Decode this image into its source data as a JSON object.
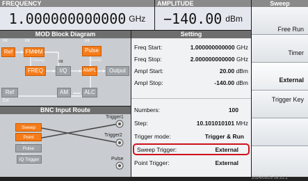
{
  "header": {
    "frequency_label": "FREQUENCY",
    "amplitude_label": "AMPLITUDE",
    "sweep_label": "Sweep"
  },
  "frequency": {
    "value": "1.000000000000",
    "unit": "GHz"
  },
  "amplitude": {
    "value": "−140.00",
    "unit": "dBm"
  },
  "mod": {
    "title": "MOD Block Diagram",
    "int1": "Int",
    "int2": "Int",
    "ref": "Ref",
    "fmpm": "FMΦM",
    "pulse": "Pulse",
    "sweep1": "Sweep",
    "int3": "Int",
    "sweep2": "Sweep",
    "freq": "FREQ",
    "iq": "I/Q",
    "ampl": "AMPL",
    "output": "Output",
    "ref2": "Ref",
    "ext": "Ext",
    "am": "AM",
    "alc": "ALC"
  },
  "bnc": {
    "title": "BNC Input Route",
    "sweep_trigger": "Sweep Trigger",
    "point_trigger": "Point Trigger",
    "pulse_trigger": "Pulse Trigger",
    "iq_trigger": "IQ Trigger",
    "trigger1": "Trigger1",
    "trigger2": "Trigger2",
    "pulse": "Pulse"
  },
  "setting": {
    "title": "Setting",
    "rows": [
      {
        "label": "Freq Start:",
        "value": "1.000000000000",
        "unit": "GHz"
      },
      {
        "label": "Freq Stop:",
        "value": "2.000000000000",
        "unit": "GHz"
      },
      {
        "label": "Ampl Start:",
        "value": "20.00",
        "unit": "dBm"
      },
      {
        "label": "Ampl Stop:",
        "value": "-140.00",
        "unit": "dBm"
      }
    ],
    "rows2": [
      {
        "label": "Numbers:",
        "value": "100",
        "unit": ""
      },
      {
        "label": "Step:",
        "value": "10.101010101",
        "unit": "MHz"
      },
      {
        "label": "Trigger mode:",
        "value": "Trigger & Run",
        "unit": ""
      },
      {
        "label": "Sweep Trigger:",
        "value": "External",
        "unit": ""
      },
      {
        "label": "Point Trigger:",
        "value": "External",
        "unit": ""
      }
    ]
  },
  "softkeys": [
    "Free Run",
    "Timer",
    "External",
    "Trigger Key"
  ],
  "status": {
    "time": "2024/09/25 09:31:2"
  }
}
